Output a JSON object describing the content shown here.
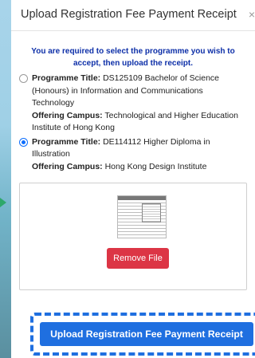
{
  "modal": {
    "title": "Upload Registration Fee Payment Receipt",
    "close_label": "×",
    "instruction": "You are required to select the programme you wish to accept, then upload the receipt.",
    "programmes": [
      {
        "programme_label": "Programme Title:",
        "programme_title": "DS125109 Bachelor of Science (Honours) in Information and Communications Technology",
        "campus_label": "Offering Campus:",
        "campus": "Technological and Higher Education Institute of Hong Kong",
        "selected": false
      },
      {
        "programme_label": "Programme Title:",
        "programme_title": "DE114112 Higher Diploma in Illustration",
        "campus_label": "Offering Campus:",
        "campus": "Hong Kong Design Institute",
        "selected": true
      }
    ],
    "remove_file_label": "Remove File",
    "upload_button_label": "Upload Registration Fee Payment Receipt"
  },
  "colors": {
    "primary": "#1f6fe0",
    "danger": "#dc3545",
    "instruction": "#0d2fa8"
  }
}
